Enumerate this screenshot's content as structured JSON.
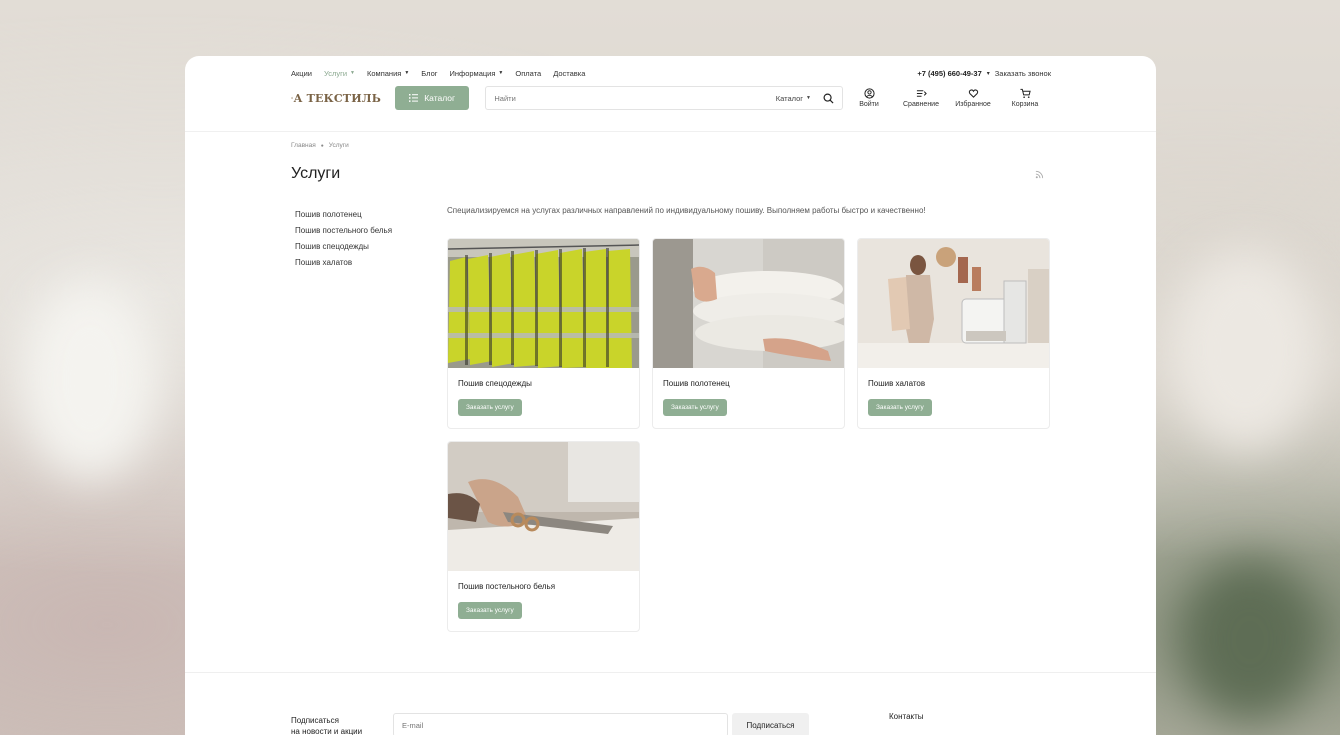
{
  "topnav": {
    "items": [
      {
        "label": "Акции",
        "caret": false,
        "active": false
      },
      {
        "label": "Услуги",
        "caret": true,
        "active": true
      },
      {
        "label": "Компания",
        "caret": true,
        "active": false
      },
      {
        "label": "Блог",
        "caret": false,
        "active": false
      },
      {
        "label": "Информация",
        "caret": true,
        "active": false
      },
      {
        "label": "Оплата",
        "caret": false,
        "active": false
      },
      {
        "label": "Доставка",
        "caret": false,
        "active": false
      }
    ],
    "phone": "+7 (495) 660-49-37",
    "callback": "Заказать звонок"
  },
  "header": {
    "logo_text": "А ТЕКСТИЛЬ",
    "catalog_label": "Каталог",
    "search_placeholder": "Найти",
    "search_scope": "Каталог",
    "actions": {
      "login": "Войти",
      "compare": "Сравнение",
      "favorites": "Избранное",
      "cart": "Корзина"
    }
  },
  "breadcrumb": {
    "home": "Главная",
    "current": "Услуги"
  },
  "page": {
    "title": "Услуги",
    "intro": "Специализируемся на услугах различных направлений по индивидуальному пошиву. Выполняем работы быстро и качественно!"
  },
  "sidebar": {
    "items": [
      "Пошив полотенец",
      "Пошив постельного белья",
      "Пошив спецодежды",
      "Пошив халатов"
    ]
  },
  "services": [
    {
      "name": "Пошив спецодежды",
      "button": "Заказать услугу"
    },
    {
      "name": "Пошив полотенец",
      "button": "Заказать услугу"
    },
    {
      "name": "Пошив халатов",
      "button": "Заказать услугу"
    },
    {
      "name": "Пошив постельного белья",
      "button": "Заказать услугу"
    }
  ],
  "footer": {
    "subscribe_line1": "Подписаться",
    "subscribe_line2": "на новости и акции",
    "email_placeholder": "E-mail",
    "subscribe_button": "Подписаться",
    "contacts_title": "Контакты"
  },
  "colors": {
    "accent": "#8fae93",
    "active_nav": "#8aa88f"
  }
}
